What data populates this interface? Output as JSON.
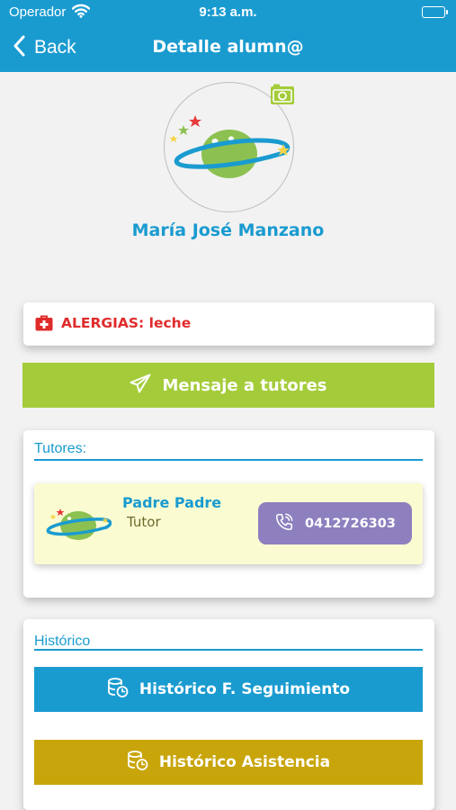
{
  "status_bar": {
    "carrier": "Operador",
    "time": "9:13 a.m."
  },
  "nav": {
    "back_label": "Back",
    "title": "Detalle alumn@"
  },
  "student": {
    "name": "María José Manzano"
  },
  "allergies": {
    "label": "ALERGIAS: leche"
  },
  "message_button": {
    "label": "Mensaje a tutores"
  },
  "tutors_section": {
    "title": "Tutores:",
    "items": [
      {
        "name": "Padre Padre",
        "role": "Tutor",
        "phone": "0412726303"
      }
    ]
  },
  "history_section": {
    "title": "Histórico",
    "follow_up_button": "Histórico F. Seguimiento",
    "attendance_button": "Histórico Asistencia"
  },
  "colors": {
    "brand_blue": "#1a9bd0",
    "message_green": "#a4cc3a",
    "phone_purple": "#8e7fbf",
    "attendance_gold": "#c8a50a",
    "allergy_red": "#e02b2b",
    "tutor_card_bg": "#fbfbd2"
  },
  "icons": {
    "wifi": "wifi-icon",
    "battery": "battery-icon",
    "back": "chevron-left-icon",
    "camera": "camera-icon",
    "avatar": "planet-icon",
    "allergy": "first-aid-kit-icon",
    "message": "paper-plane-icon",
    "phone": "phone-icon",
    "history": "database-clock-icon"
  }
}
